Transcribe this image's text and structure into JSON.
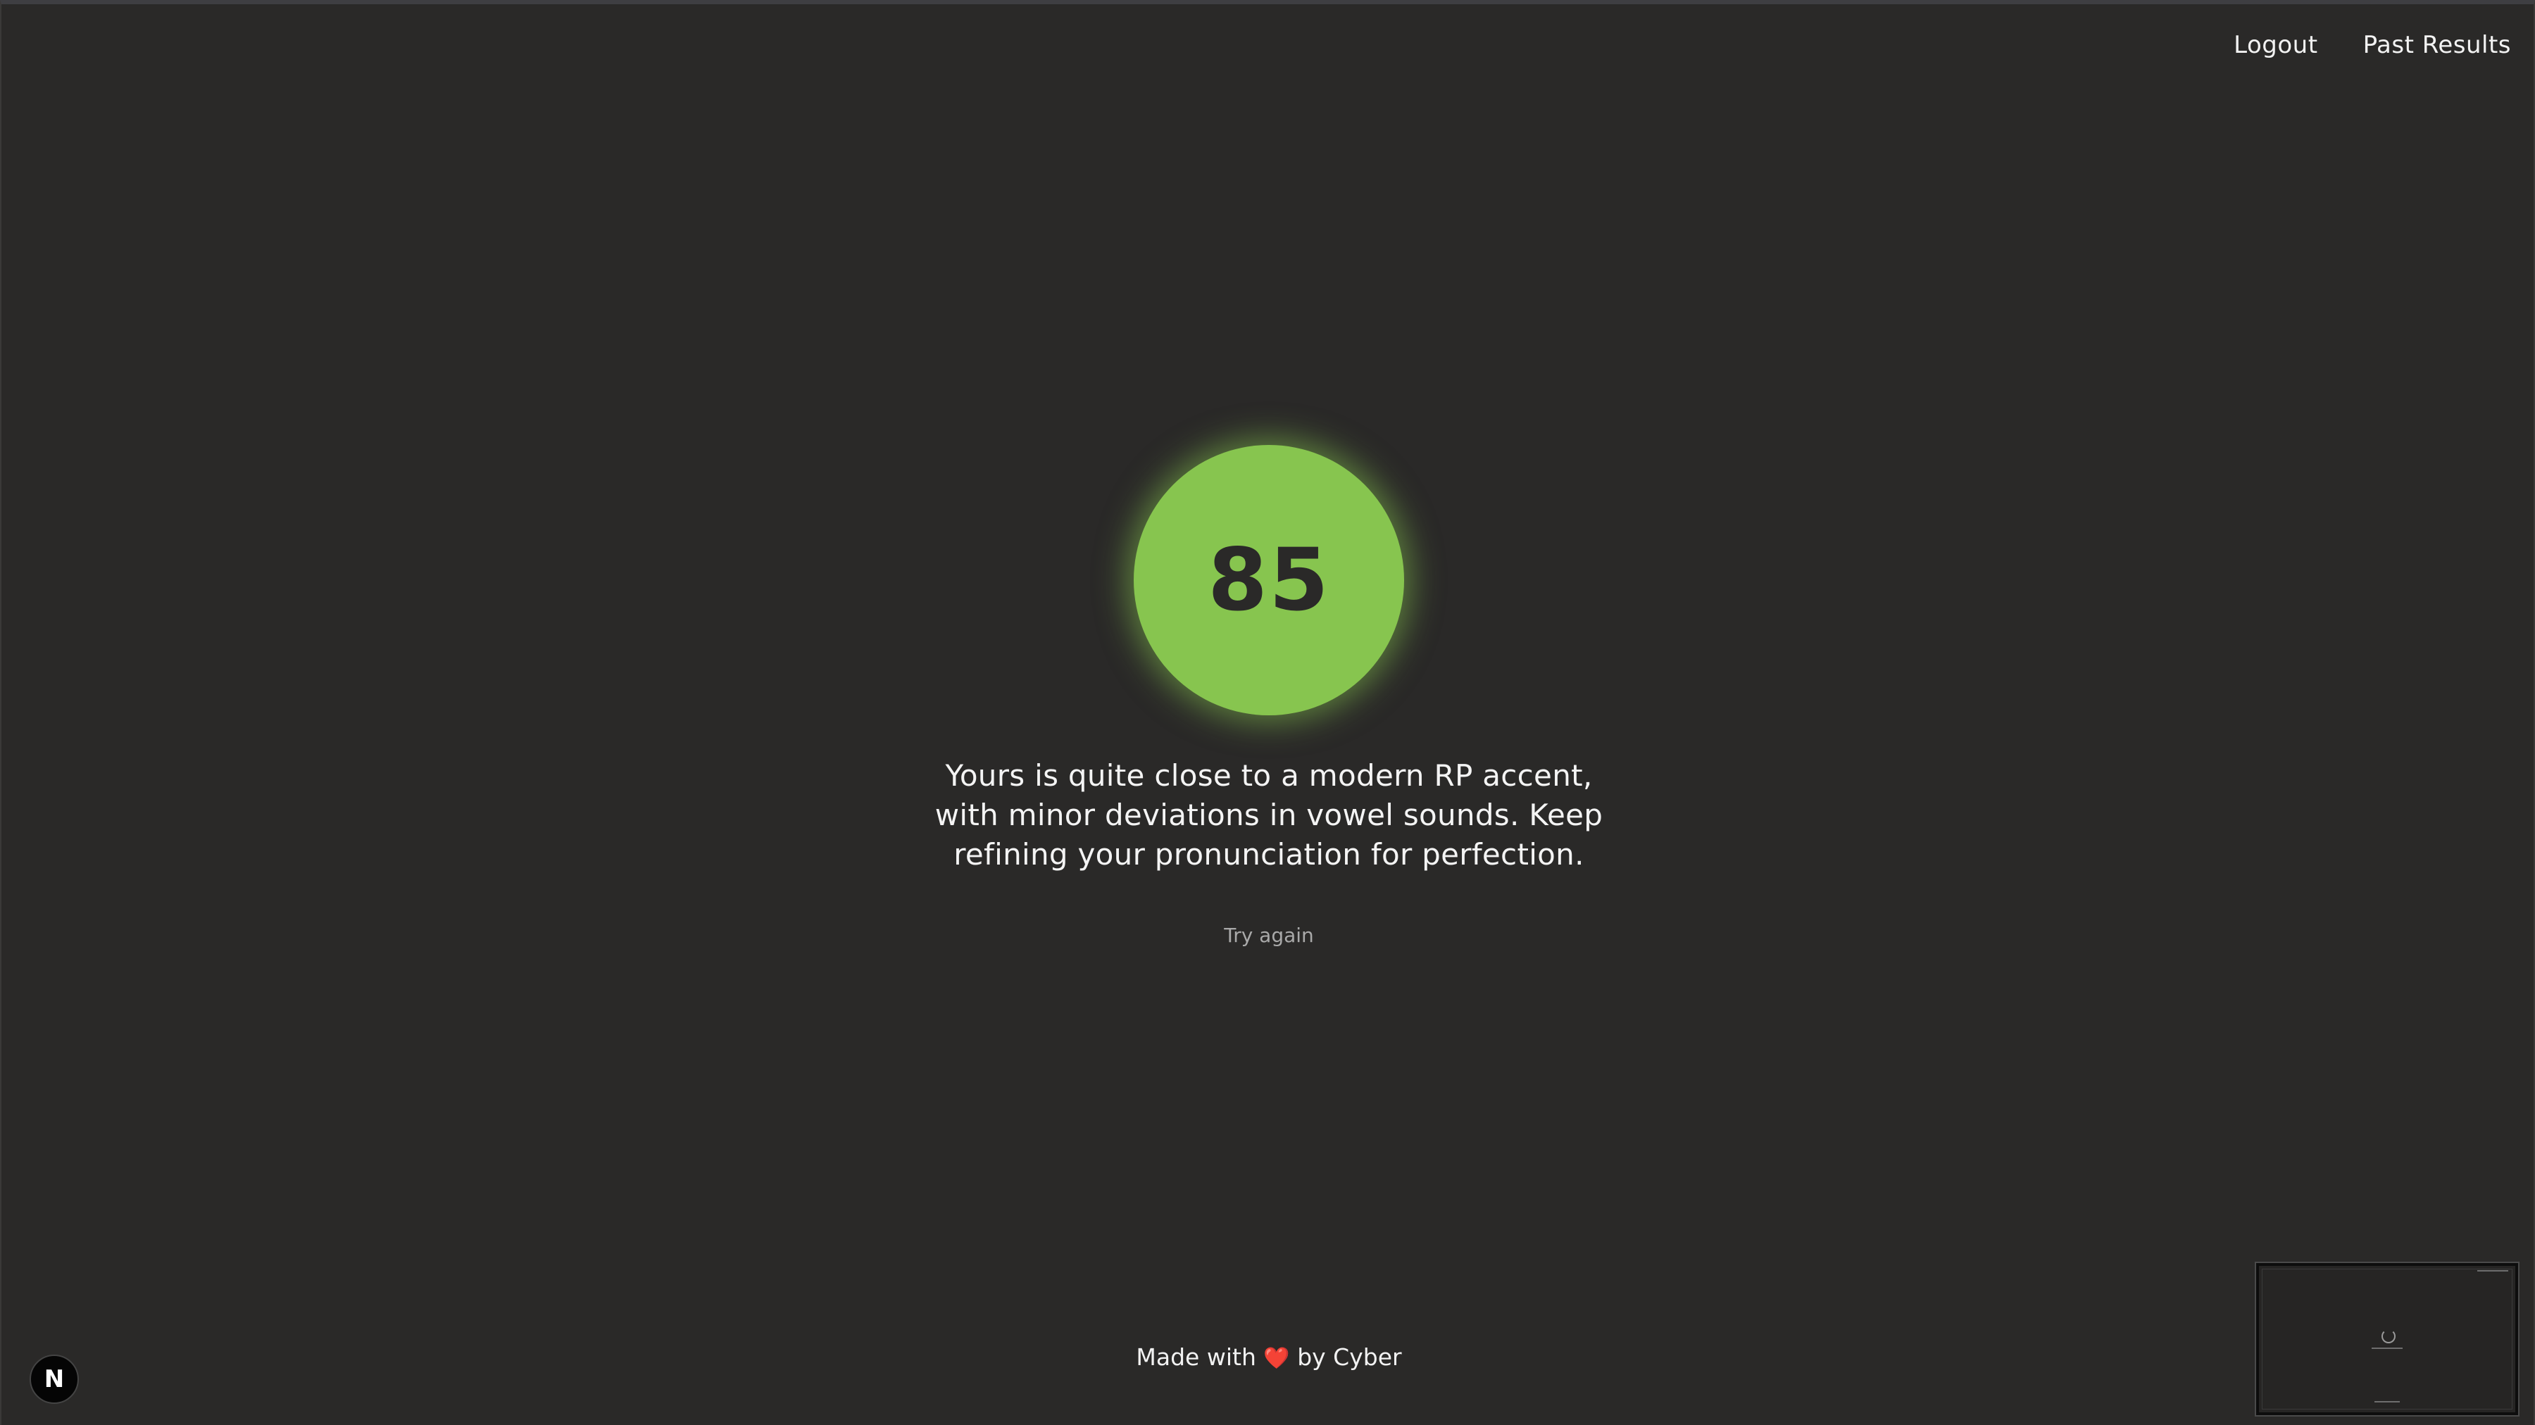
{
  "nav": {
    "logout_label": "Logout",
    "past_results_label": "Past Results"
  },
  "result": {
    "score": "85",
    "feedback": "Yours is quite close to a modern RP accent, with minor deviations in vowel sounds. Keep refining your pronunciation for perfection.",
    "try_again_label": "Try again"
  },
  "footer": {
    "prefix": "Made with",
    "heart": "❤️",
    "suffix": "by Cyber"
  },
  "badge": {
    "letter": "N"
  },
  "colors": {
    "background": "#2a2928",
    "score_circle": "#87c54f",
    "text": "#f2f2f2",
    "muted_text": "#a9a9a9"
  },
  "icons": {
    "badge": "nextjs-n-icon",
    "thumbnail": "window-preview-thumbnail"
  }
}
